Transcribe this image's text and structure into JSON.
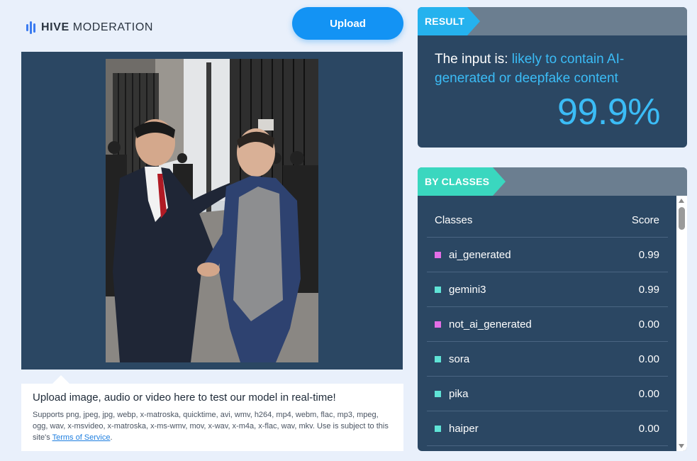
{
  "header": {
    "logo_bold": "HIVE",
    "logo_light": "MODERATION",
    "upload_label": "Upload"
  },
  "upload_info": {
    "title": "Upload image, audio or video here to test our model in real-time!",
    "desc": "Supports png, jpeg, jpg, webp, x-matroska, quicktime, avi, wmv, h264, mp4, webm, flac, mp3, mpeg, ogg, wav, x-msvideo, x-matroska, x-ms-wmv, mov, x-wav, x-m4a, x-flac, wav, mkv. Use is subject to this site's ",
    "tos_link": "Terms of Service",
    "desc_end": "."
  },
  "result": {
    "tag": "RESULT",
    "prefix": "The input is: ",
    "verdict": "likely to contain AI-generated or deepfake content",
    "score": "99.9%"
  },
  "classes": {
    "tag": "BY CLASSES",
    "col_class": "Classes",
    "col_score": "Score",
    "rows": [
      {
        "name": "ai_generated",
        "score": "0.99",
        "color": "#e36ee6"
      },
      {
        "name": "gemini3",
        "score": "0.99",
        "color": "#5fe3d6"
      },
      {
        "name": "not_ai_generated",
        "score": "0.00",
        "color": "#e36ee6"
      },
      {
        "name": "sora",
        "score": "0.00",
        "color": "#5fe3d6"
      },
      {
        "name": "pika",
        "score": "0.00",
        "color": "#5fe3d6"
      },
      {
        "name": "haiper",
        "score": "0.00",
        "color": "#5fe3d6"
      }
    ]
  },
  "colors": {
    "accent_blue": "#1393f4",
    "panel": "#2b4763",
    "highlight": "#3bbcf6",
    "classes_tag": "#3ad7bf"
  }
}
